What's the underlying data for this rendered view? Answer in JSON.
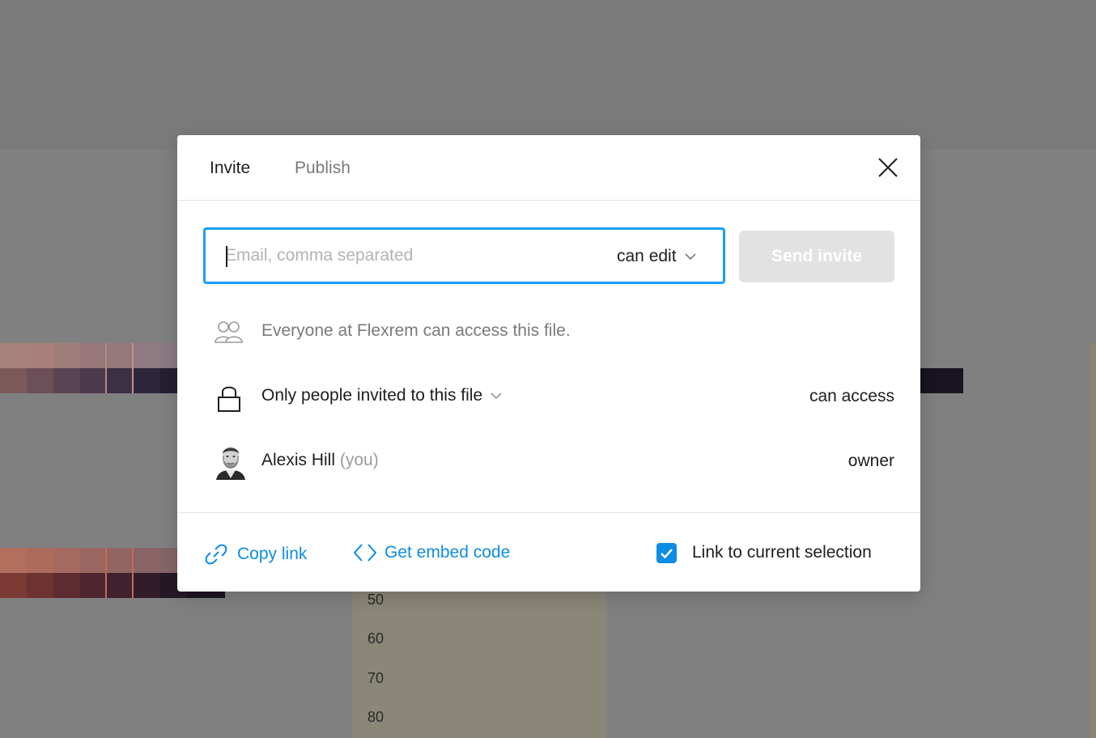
{
  "dialog": {
    "tabs": [
      {
        "label": "Invite",
        "active": true
      },
      {
        "label": "Publish",
        "active": false
      }
    ],
    "invite": {
      "email_placeholder": "Email, comma separated",
      "email_value": "",
      "permission": "can edit",
      "send_label": "Send invite"
    },
    "org_notice": "Everyone at Flexrem can access this file.",
    "link_access": {
      "scope": "Only people invited to this file",
      "permission": "can access"
    },
    "members": [
      {
        "name": "Alexis Hill",
        "suffix": "(you)",
        "role": "owner"
      }
    ],
    "footer": {
      "copy_link": "Copy link",
      "embed_code": "Get embed code",
      "link_selection_label": "Link to current selection",
      "link_selection_checked": true
    }
  },
  "background": {
    "scale_labels": [
      "50",
      "60",
      "70",
      "80"
    ]
  },
  "colors": {
    "accent": "#18a0fb",
    "link": "#0d8ce6",
    "overlay": "#808080",
    "disabled_button": "#e2e2e2"
  },
  "icons": {
    "close": "close-icon",
    "org": "team-icon",
    "lock": "lock-icon",
    "link": "link-icon",
    "embed": "code-icon",
    "check": "check-icon"
  }
}
